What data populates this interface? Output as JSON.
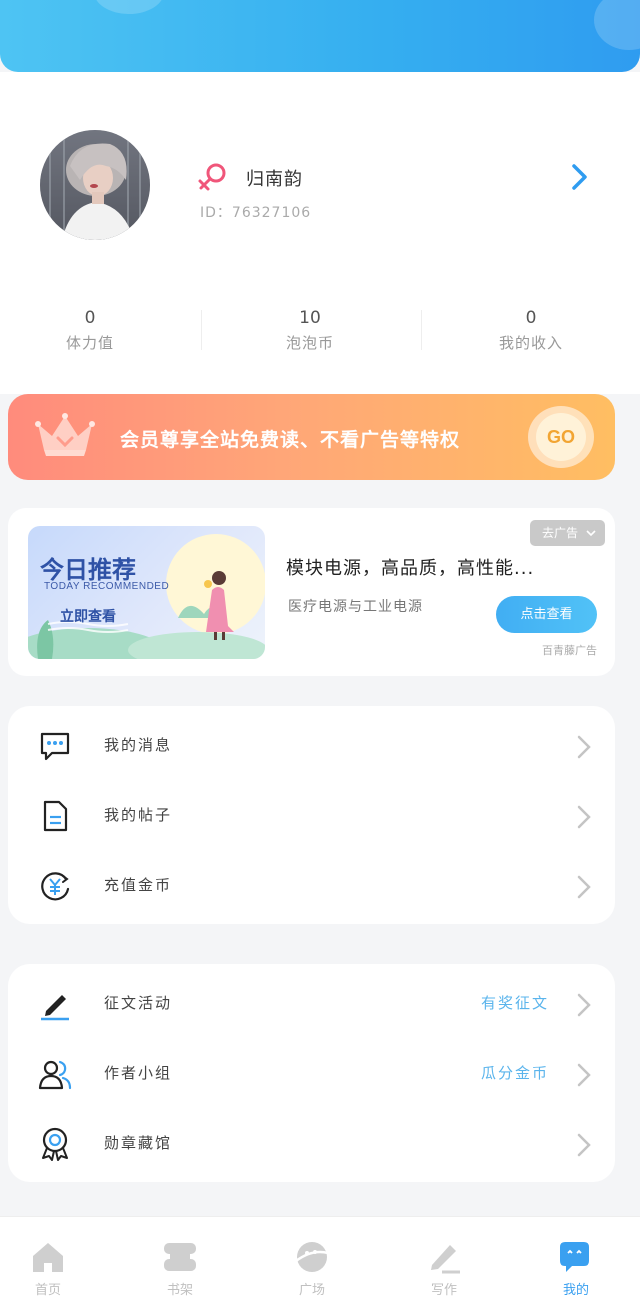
{
  "profile": {
    "username": "归南韵",
    "id_label": "ID：",
    "id_value": "76327106",
    "gender": "female"
  },
  "stats": [
    {
      "value": "0",
      "label": "体力值"
    },
    {
      "value": "10",
      "label": "泡泡币"
    },
    {
      "value": "0",
      "label": "我的收入"
    }
  ],
  "vip_banner": {
    "text": "会员尊享全站免费读、不看广告等特权",
    "go_label": "GO"
  },
  "ad": {
    "banner_title": "今日推荐",
    "banner_subtitle": "TODAY RECOMMENDED",
    "banner_cta": "立即查看",
    "close_label": "去广告",
    "title": "模块电源，高品质，高性能...",
    "description": "医疗电源与工业电源",
    "button_label": "点击查看",
    "source": "百青藤广告"
  },
  "menu_group_1": [
    {
      "label": "我的消息",
      "icon": "message-icon"
    },
    {
      "label": "我的帖子",
      "icon": "document-icon"
    },
    {
      "label": "充值金币",
      "icon": "yuan-coin-icon"
    }
  ],
  "menu_group_2": [
    {
      "label": "征文活动",
      "extra": "有奖征文",
      "icon": "pen-icon"
    },
    {
      "label": "作者小组",
      "extra": "瓜分金币",
      "icon": "group-icon"
    },
    {
      "label": "勋章藏馆",
      "extra": "",
      "icon": "medal-icon"
    }
  ],
  "tabs": [
    {
      "label": "首页",
      "icon": "home-icon"
    },
    {
      "label": "书架",
      "icon": "bookshelf-icon"
    },
    {
      "label": "广场",
      "icon": "planet-icon"
    },
    {
      "label": "写作",
      "icon": "write-icon"
    },
    {
      "label": "我的",
      "icon": "profile-bubble-icon",
      "active": true
    }
  ],
  "colors": {
    "accent": "#3aa0f0",
    "header_gradient_start": "#4ec4f3",
    "vip_gradient_start": "#ff8b7c",
    "vip_gradient_end": "#ffbe62",
    "link_blue": "#5ab4ec"
  }
}
